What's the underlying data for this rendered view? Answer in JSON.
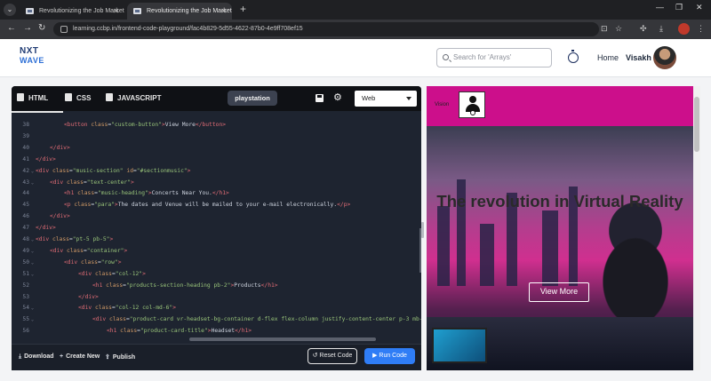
{
  "browser": {
    "tabs": [
      {
        "title": "Revolutionizing the Job Market",
        "active": false
      },
      {
        "title": "Revolutionizing the Job Market",
        "active": true
      }
    ],
    "url": "learning.ccbp.in/frontend-code-playground/fac4b829-5d55-4622-87b0-4e9ff708ef15",
    "window_controls": [
      "—",
      "❐",
      "✕"
    ]
  },
  "site": {
    "logo_top": "NXT",
    "logo_bottom": "WAVE",
    "search_placeholder": "Search for 'Arrays'",
    "home_label": "Home",
    "user_name": "Visakh"
  },
  "editor": {
    "tabs": [
      "HTML",
      "CSS",
      "JAVASCRIPT"
    ],
    "active_tab": "HTML",
    "project_name": "playstation",
    "view_select": "Web",
    "lines": [
      {
        "num": "38",
        "fold": "",
        "indent": 2,
        "html": "<span class=\"tg\">&lt;button</span> <span class=\"at\">class</span>=<span class=\"st\">\"custom-button\"</span><span class=\"tg\">&gt;</span>View More<span class=\"tg\">&lt;/button&gt;</span>"
      },
      {
        "num": "39",
        "fold": "",
        "indent": 0,
        "html": ""
      },
      {
        "num": "40",
        "fold": "",
        "indent": 1,
        "html": "<span class=\"tg\">&lt;/div&gt;</span>"
      },
      {
        "num": "41",
        "fold": "",
        "indent": 0,
        "html": "<span class=\"tg\">&lt;/div&gt;</span>"
      },
      {
        "num": "42",
        "fold": "v",
        "indent": 0,
        "html": "<span class=\"tg\">&lt;div</span> <span class=\"at\">class</span>=<span class=\"st\">\"music-section\"</span> <span class=\"at\">id</span>=<span class=\"st\">\"#sectionmusic\"</span><span class=\"tg\">&gt;</span>"
      },
      {
        "num": "43",
        "fold": "v",
        "indent": 1,
        "html": "<span class=\"tg\">&lt;div</span> <span class=\"at\">class</span>=<span class=\"st\">\"text-center\"</span><span class=\"tg\">&gt;</span>"
      },
      {
        "num": "44",
        "fold": "",
        "indent": 2,
        "html": "<span class=\"tg\">&lt;h1</span> <span class=\"at\">class</span>=<span class=\"st\">\"music-heading\"</span><span class=\"tg\">&gt;</span>Concerts Near You.<span class=\"tg\">&lt;/h1&gt;</span>"
      },
      {
        "num": "45",
        "fold": "",
        "indent": 2,
        "html": "<span class=\"tg\">&lt;p</span> <span class=\"at\">class</span>=<span class=\"st\">\"para\"</span><span class=\"tg\">&gt;</span>The dates and Venue will be mailed to your e-mail electronically.<span class=\"tg\">&lt;/p&gt;</span>"
      },
      {
        "num": "46",
        "fold": "",
        "indent": 1,
        "html": "<span class=\"tg\">&lt;/div&gt;</span>"
      },
      {
        "num": "47",
        "fold": "",
        "indent": 0,
        "html": "<span class=\"tg\">&lt;/div&gt;</span>"
      },
      {
        "num": "48",
        "fold": "v",
        "indent": 0,
        "html": "<span class=\"tg\">&lt;div</span> <span class=\"at\">class</span>=<span class=\"st\">\"pt-5 pb-5\"</span><span class=\"tg\">&gt;</span>"
      },
      {
        "num": "49",
        "fold": "v",
        "indent": 1,
        "html": "<span class=\"tg\">&lt;div</span> <span class=\"at\">class</span>=<span class=\"st\">\"container\"</span><span class=\"tg\">&gt;</span>"
      },
      {
        "num": "50",
        "fold": "v",
        "indent": 2,
        "html": "<span class=\"tg\">&lt;div</span> <span class=\"at\">class</span>=<span class=\"st\">\"row\"</span><span class=\"tg\">&gt;</span>"
      },
      {
        "num": "51",
        "fold": "v",
        "indent": 3,
        "html": "<span class=\"tg\">&lt;div</span> <span class=\"at\">class</span>=<span class=\"st\">\"col-12\"</span><span class=\"tg\">&gt;</span>"
      },
      {
        "num": "52",
        "fold": "",
        "indent": 4,
        "html": "<span class=\"tg\">&lt;h1</span> <span class=\"at\">class</span>=<span class=\"st\">\"products-section-heading pb-2\"</span><span class=\"tg\">&gt;</span>Products<span class=\"tg\">&lt;/h1&gt;</span>"
      },
      {
        "num": "53",
        "fold": "",
        "indent": 3,
        "html": "<span class=\"tg\">&lt;/div&gt;</span>"
      },
      {
        "num": "54",
        "fold": "v",
        "indent": 3,
        "html": "<span class=\"tg\">&lt;div</span> <span class=\"at\">class</span>=<span class=\"st\">\"col-12 col-md-6\"</span><span class=\"tg\">&gt;</span>"
      },
      {
        "num": "55",
        "fold": "v",
        "indent": 4,
        "html": "<span class=\"tg\">&lt;div</span> <span class=\"at\">class</span>=<span class=\"st\">\"product-card vr-headset-bg-container d-flex flex-column justify-content-center p-3 mb-</span>"
      },
      {
        "num": "56",
        "fold": "",
        "indent": 5,
        "html": "<span class=\"tg\">&lt;h1</span> <span class=\"at\">class</span>=<span class=\"st\">\"product-card-title\"</span><span class=\"tg\">&gt;</span>Headset<span class=\"tg\">&lt;/h1&gt;</span>"
      }
    ],
    "footer": {
      "download": "Download",
      "create_new": "Create New",
      "publish": "Publish",
      "reset": "Reset Code",
      "run": "Run Code"
    }
  },
  "preview": {
    "brand": "Vision",
    "title": "The revolution in Virtual Reality",
    "button": "View More",
    "colors": {
      "navbar": "#cc0f8b",
      "button_border": "#ffffff"
    }
  }
}
